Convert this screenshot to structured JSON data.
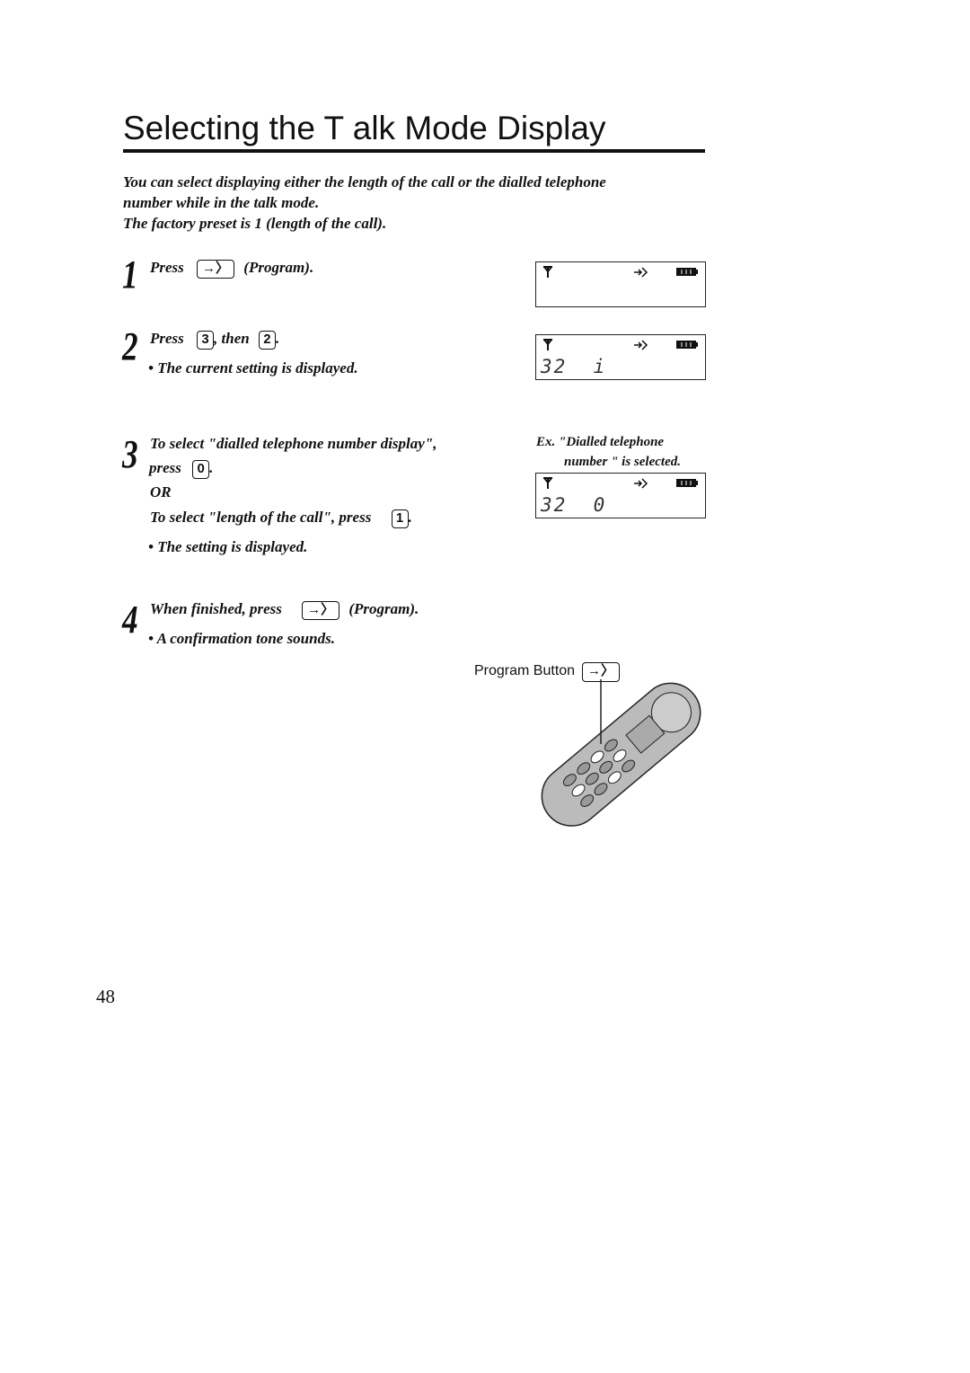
{
  "title": "Selecting the T alk Mode Display",
  "intro": [
    "You can select displaying either the length of the call or the dialled telephone",
    "number while in the talk mode.",
    "The factory preset is 1 (length of the call)."
  ],
  "steps": {
    "s1": {
      "num": "1",
      "press": "Press",
      "after": "(Program)."
    },
    "s2": {
      "num": "2",
      "press": "Press",
      "key1": "3",
      "then": ", then",
      "key2": "2",
      "end": ".",
      "bullet": "• The current setting is displayed."
    },
    "s3": {
      "num": "3",
      "line1": "To select \"dialled telephone number display\",",
      "press": "press",
      "key": "0",
      "end": ".",
      "or": "OR",
      "line2": "To select \"length of the call\", press",
      "key2": "1",
      "end2": ".",
      "bullet": "• The setting is displayed."
    },
    "s4": {
      "num": "4",
      "text": "When finished, press",
      "after": "(Program).",
      "bullet": "• A confirmation tone sounds."
    }
  },
  "displays": {
    "d2": "32  i",
    "d3": "32  0"
  },
  "example": [
    "Ex. \"Dialled telephone",
    "number \" is selected."
  ],
  "figure": {
    "label": "Program Button"
  },
  "page_number": "48",
  "icons": [
    "antenna-icon",
    "program-arrow-icon",
    "battery-icon"
  ]
}
